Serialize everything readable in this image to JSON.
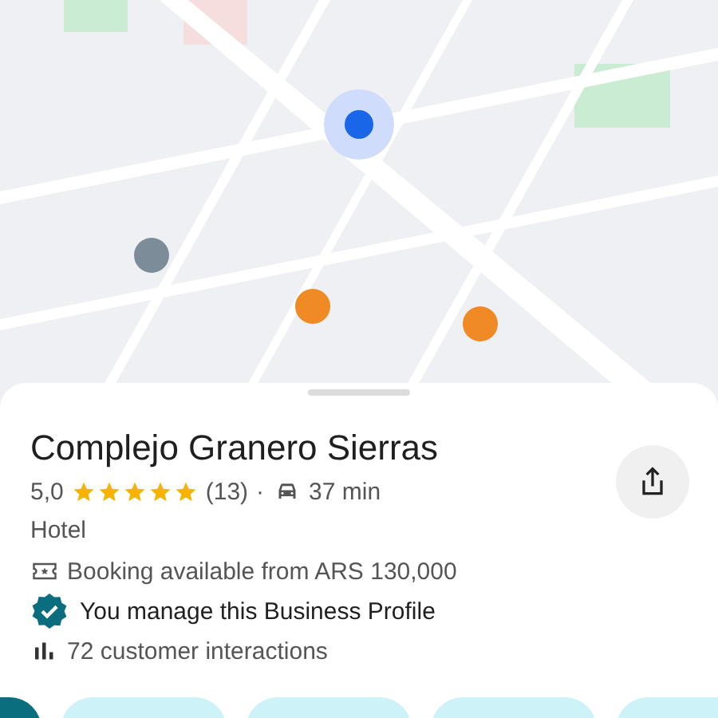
{
  "place": {
    "name": "Complejo Granero Sierras",
    "rating": "5,0",
    "stars": 5,
    "reviews": "(13)",
    "separator": "·",
    "drive_time": "37 min",
    "category": "Hotel",
    "booking": "Booking available from ARS 130,000",
    "managed": "You manage this Business Profile",
    "interactions": "72 customer interactions"
  },
  "action_chips": [
    {
      "kind": "primary"
    },
    {
      "kind": "secondary"
    },
    {
      "kind": "secondary"
    },
    {
      "kind": "secondary"
    },
    {
      "kind": "secondary"
    }
  ]
}
